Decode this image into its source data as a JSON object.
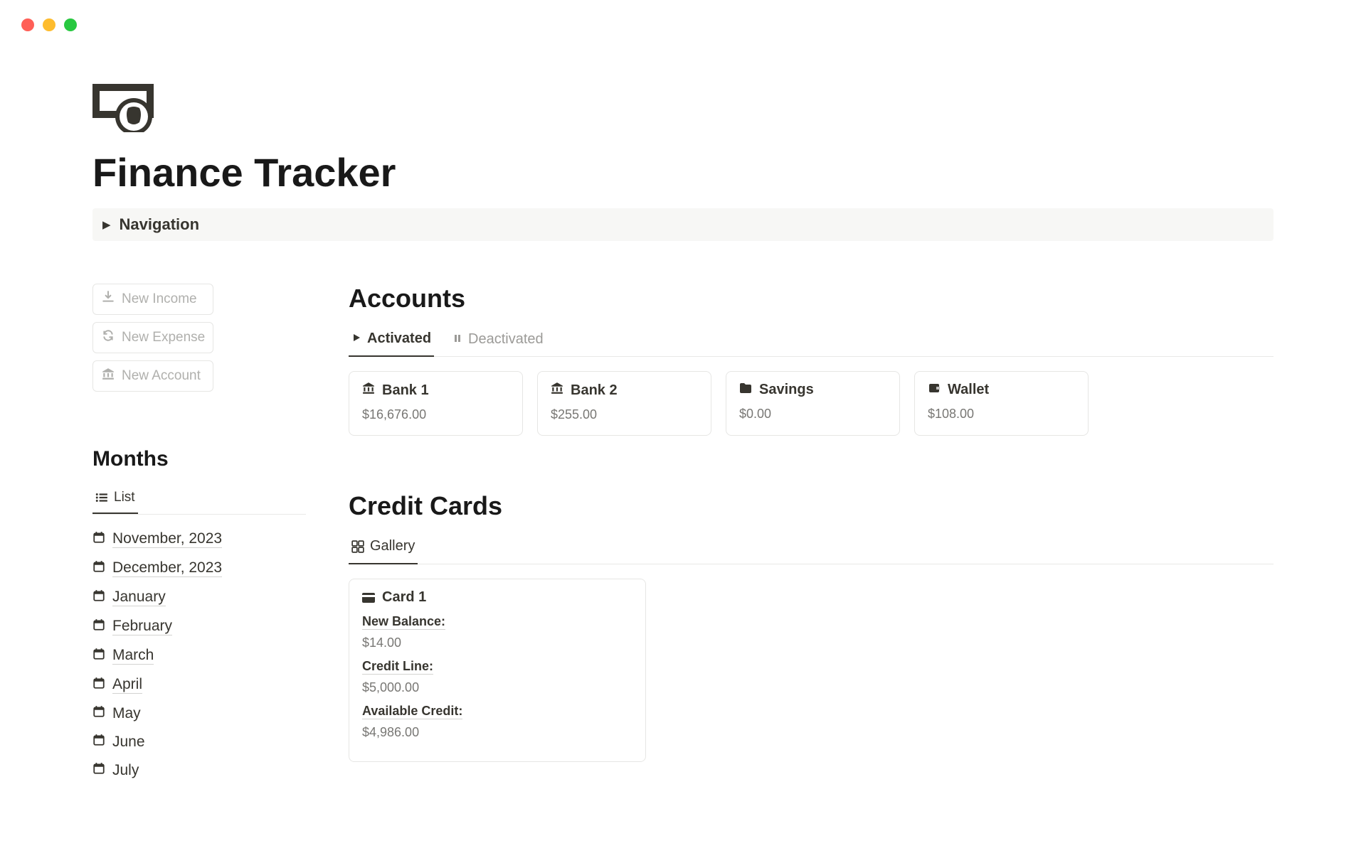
{
  "page_title": "Finance Tracker",
  "navigation_label": "Navigation",
  "sidebar": {
    "new_buttons": [
      {
        "label": "New Income",
        "icon": "download"
      },
      {
        "label": "New Expense",
        "icon": "cycle"
      },
      {
        "label": "New Account",
        "icon": "bank"
      }
    ],
    "months_heading": "Months",
    "months_tab_label": "List",
    "months": [
      {
        "label": "November, 2023",
        "underline": true
      },
      {
        "label": "December, 2023",
        "underline": true
      },
      {
        "label": "January",
        "underline": true
      },
      {
        "label": "February",
        "underline": true
      },
      {
        "label": "March",
        "underline": true
      },
      {
        "label": "April",
        "underline": true
      },
      {
        "label": "May",
        "underline": false
      },
      {
        "label": "June",
        "underline": false
      },
      {
        "label": "July",
        "underline": false
      }
    ]
  },
  "accounts": {
    "heading": "Accounts",
    "tabs": [
      {
        "label": "Activated",
        "icon": "play",
        "active": true
      },
      {
        "label": "Deactivated",
        "icon": "pause",
        "active": false
      }
    ],
    "items": [
      {
        "name": "Bank 1",
        "icon": "bank",
        "amount": "$16,676.00"
      },
      {
        "name": "Bank 2",
        "icon": "bank",
        "amount": "$255.00"
      },
      {
        "name": "Savings",
        "icon": "folder",
        "amount": "$0.00"
      },
      {
        "name": "Wallet",
        "icon": "wallet",
        "amount": "$108.00"
      }
    ]
  },
  "credit_cards": {
    "heading": "Credit Cards",
    "tab_label": "Gallery",
    "card": {
      "name": "Card 1",
      "fields": [
        {
          "label": "New Balance:",
          "value": "$14.00"
        },
        {
          "label": "Credit Line:",
          "value": "$5,000.00"
        },
        {
          "label": "Available Credit:",
          "value": "$4,986.00"
        }
      ]
    }
  }
}
